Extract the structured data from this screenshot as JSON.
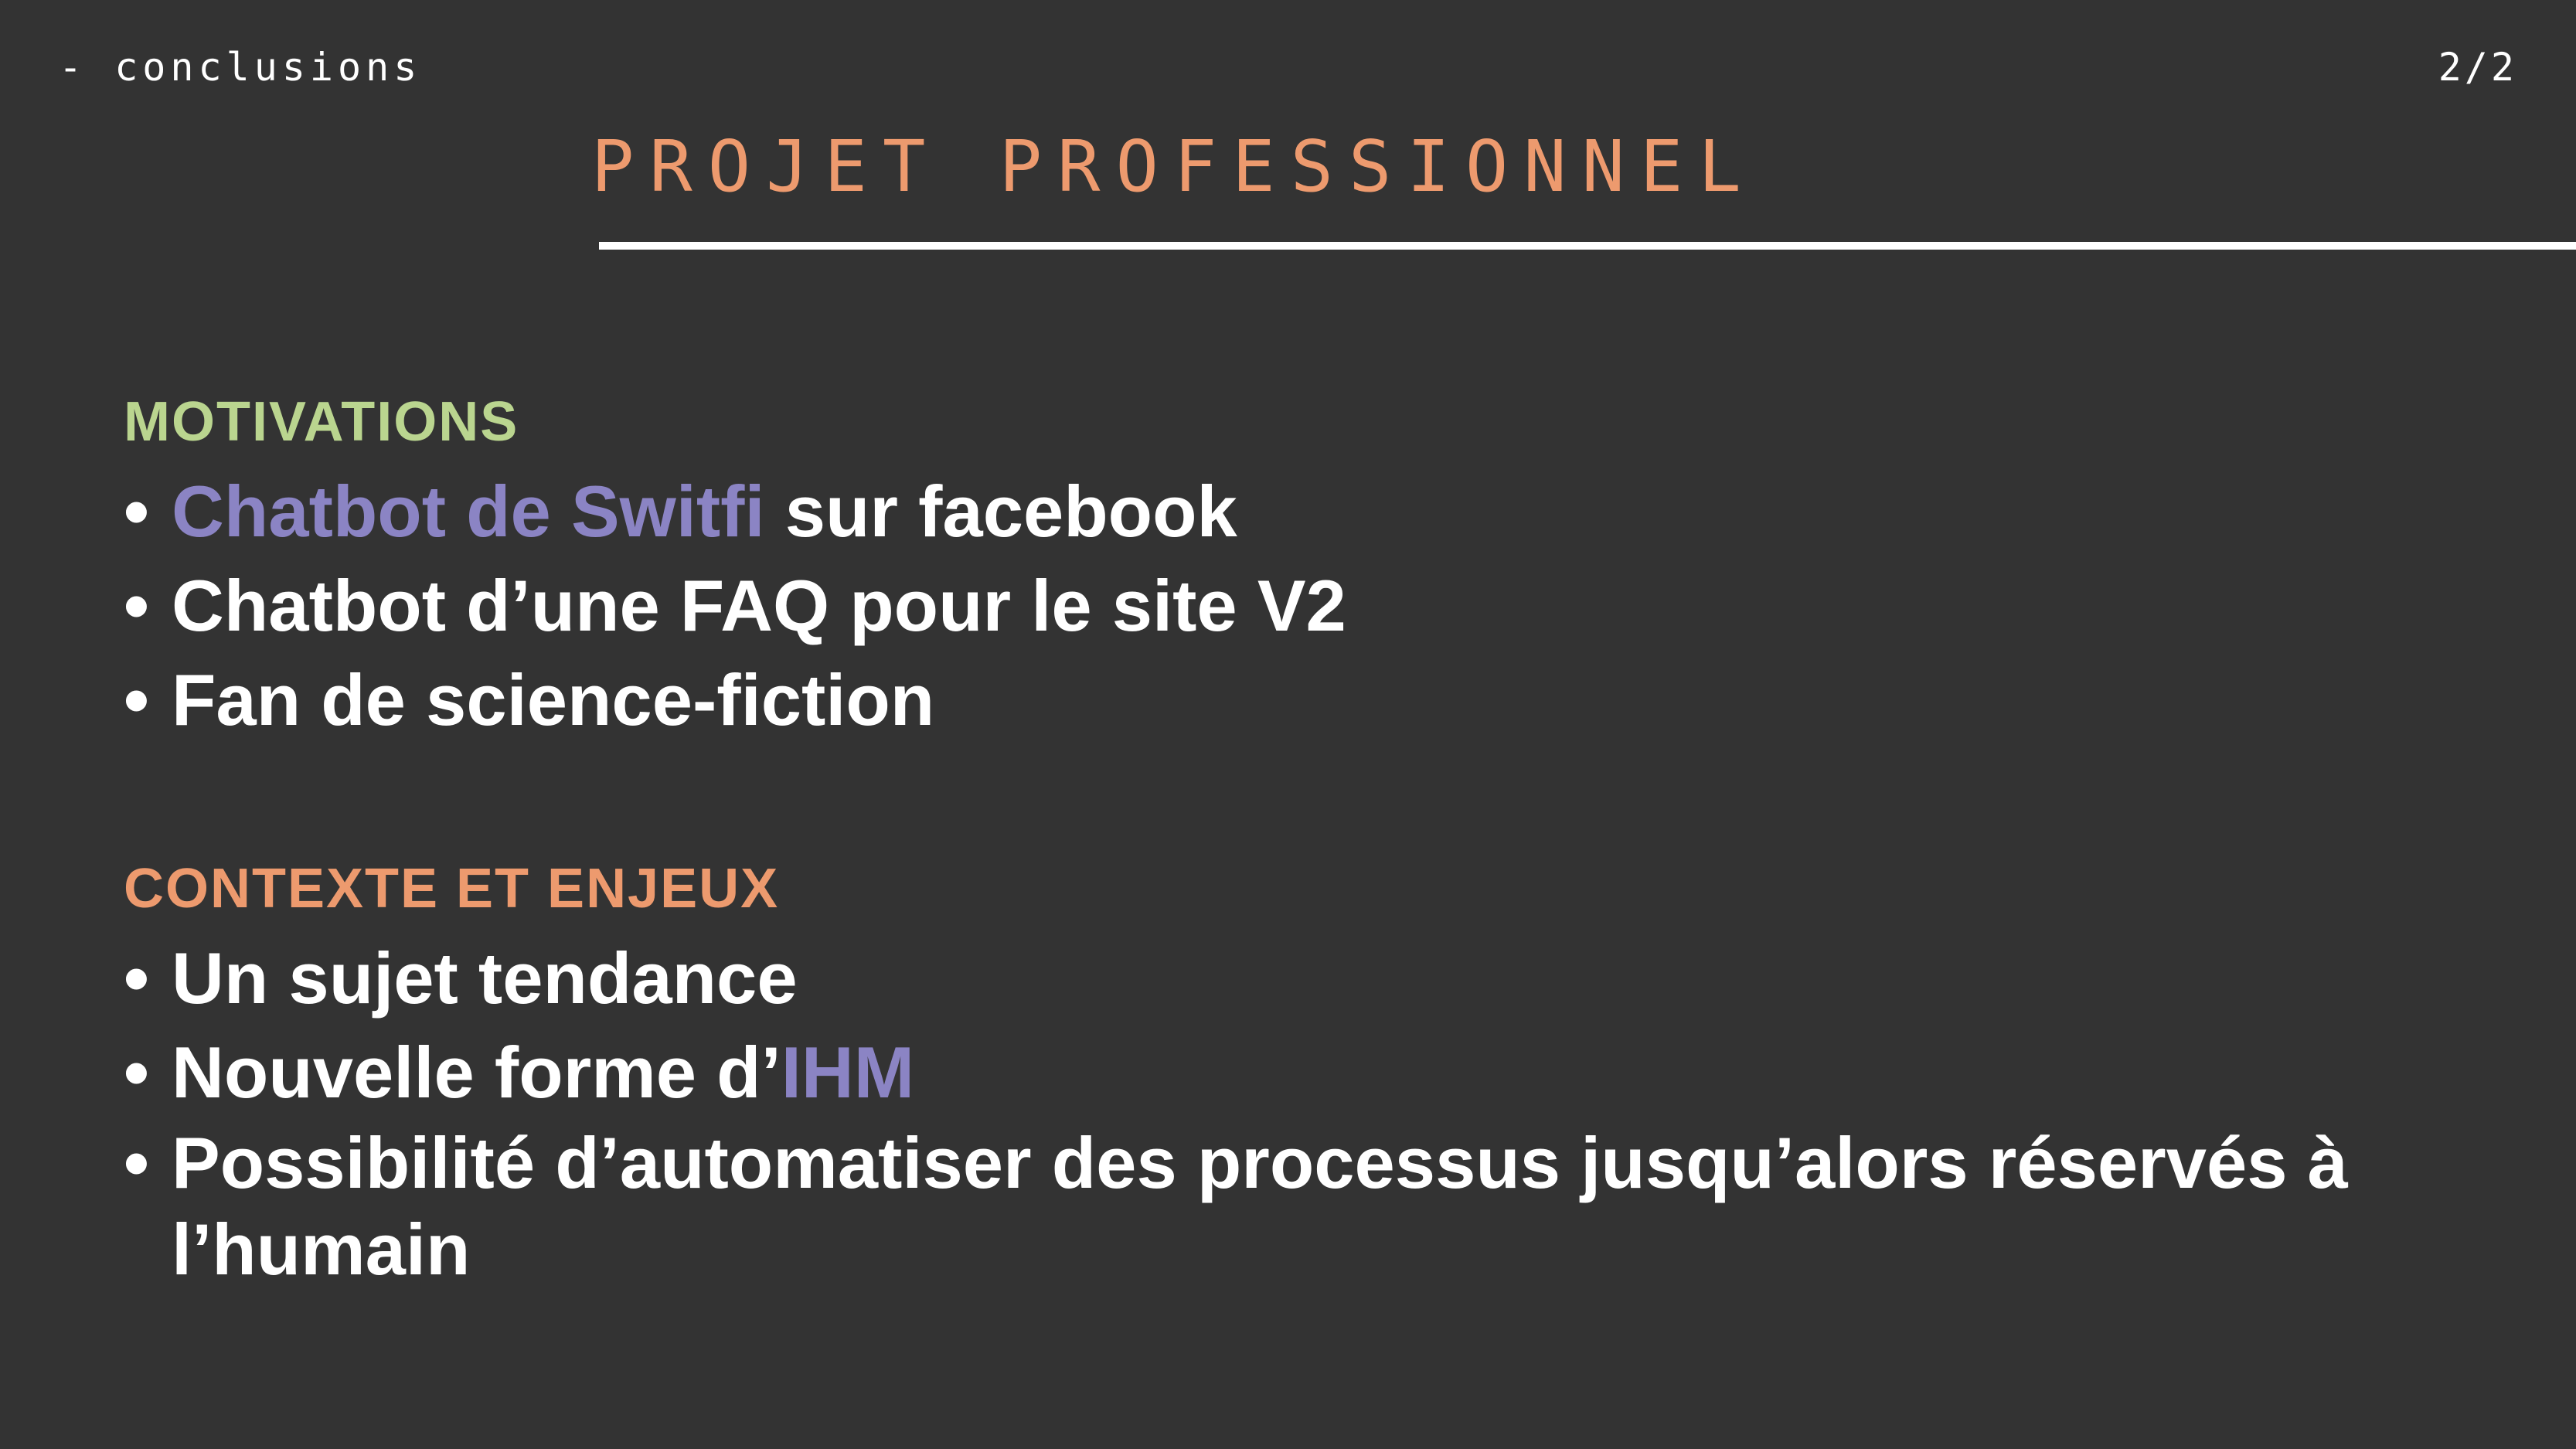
{
  "header": {
    "section": "- conclusions",
    "page": "2/2"
  },
  "title": "PROJET PROFESSIONNEL",
  "motivations": {
    "heading": "MOTIVATIONS",
    "items": [
      {
        "highlight": "Chatbot de Switfi",
        "text": " sur facebook"
      },
      {
        "text": "Chatbot d’une FAQ pour le site V2"
      },
      {
        "text": "Fan de science-fiction"
      }
    ]
  },
  "context": {
    "heading": "CONTEXTE ET ENJEUX",
    "items": [
      {
        "text": "Un sujet tendance"
      },
      {
        "text": "Nouvelle forme d’",
        "highlight": "IHM"
      },
      {
        "text": "Possibilité d’automatiser des processus jusqu’alors réservés à l’humain"
      }
    ]
  },
  "colors": {
    "background": "#333333",
    "title": "#ED9A6E",
    "motivations_heading": "#BAD58F",
    "context_heading": "#ED9A6E",
    "highlight": "#8B84C4",
    "text": "#FFFFFF"
  }
}
